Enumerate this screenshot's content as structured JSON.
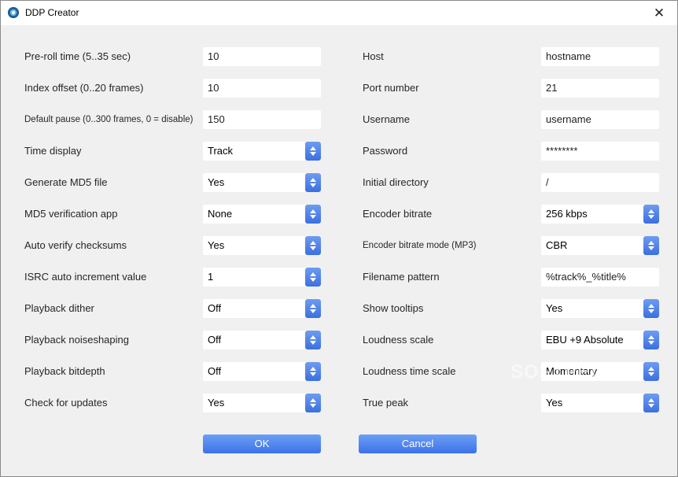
{
  "window": {
    "title": "DDP Creator",
    "close_glyph": "✕",
    "app_icon": "app-logo-icon"
  },
  "left": [
    {
      "label": "Pre-roll time (5..35 sec)",
      "kind": "input",
      "value": "10",
      "size": "normal"
    },
    {
      "label": "Index offset (0..20 frames)",
      "kind": "input",
      "value": "10",
      "size": "normal"
    },
    {
      "label": "Default pause (0..300 frames, 0 = disable)",
      "kind": "input",
      "value": "150",
      "size": "small"
    },
    {
      "label": "Time display",
      "kind": "select",
      "value": "Track",
      "size": "normal"
    },
    {
      "label": "Generate MD5 file",
      "kind": "select",
      "value": "Yes",
      "size": "normal"
    },
    {
      "label": "MD5 verification app",
      "kind": "select",
      "value": "None",
      "size": "normal"
    },
    {
      "label": "Auto verify checksums",
      "kind": "select",
      "value": "Yes",
      "size": "normal"
    },
    {
      "label": "ISRC auto increment value",
      "kind": "select",
      "value": "1",
      "size": "normal"
    },
    {
      "label": "Playback dither",
      "kind": "select",
      "value": "Off",
      "size": "normal"
    },
    {
      "label": "Playback noiseshaping",
      "kind": "select",
      "value": "Off",
      "size": "normal"
    },
    {
      "label": "Playback bitdepth",
      "kind": "select",
      "value": "Off",
      "size": "normal"
    },
    {
      "label": "Check for updates",
      "kind": "select",
      "value": "Yes",
      "size": "normal"
    }
  ],
  "right": [
    {
      "label": "Host",
      "kind": "input",
      "value": "hostname",
      "size": "normal"
    },
    {
      "label": "Port number",
      "kind": "input",
      "value": "21",
      "size": "normal"
    },
    {
      "label": "Username",
      "kind": "input",
      "value": "username",
      "size": "normal"
    },
    {
      "label": "Password",
      "kind": "input",
      "value": "********",
      "size": "normal"
    },
    {
      "label": "Initial directory",
      "kind": "input",
      "value": "/",
      "size": "normal"
    },
    {
      "label": "Encoder bitrate",
      "kind": "select",
      "value": "256 kbps",
      "size": "normal"
    },
    {
      "label": "Encoder bitrate mode (MP3)",
      "kind": "select",
      "value": "CBR",
      "size": "small"
    },
    {
      "label": "Filename pattern",
      "kind": "input",
      "value": "%track%_%title%",
      "size": "normal"
    },
    {
      "label": "Show tooltips",
      "kind": "select",
      "value": "Yes",
      "size": "normal"
    },
    {
      "label": "Loudness scale",
      "kind": "select",
      "value": "EBU +9 Absolute",
      "size": "normal"
    },
    {
      "label": "Loudness time scale",
      "kind": "select",
      "value": "Momentary",
      "size": "normal"
    },
    {
      "label": "True peak",
      "kind": "select",
      "value": "Yes",
      "size": "normal"
    }
  ],
  "buttons": {
    "ok": "OK",
    "cancel": "Cancel"
  },
  "watermark": "SOFTPEDIA",
  "colors": {
    "accent": "#4a80ee",
    "window_bg": "#f0f0f0",
    "field_bg": "#ffffff"
  }
}
